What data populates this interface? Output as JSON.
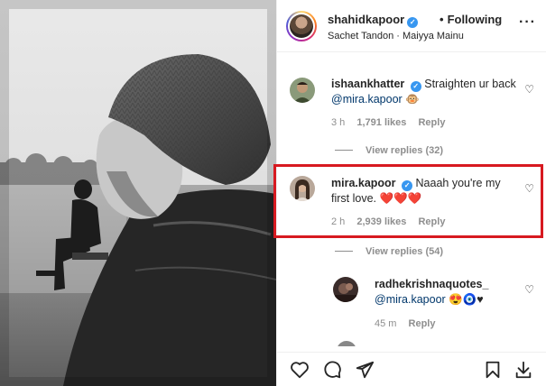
{
  "post": {
    "username": "shahidkapoor",
    "follow_status": "Following",
    "audio_line": "Sachet Tandon · Maiyya Mainu",
    "more_label": "···"
  },
  "comments": [
    {
      "username": "ishaankhatter",
      "text": "Straighten ur back",
      "mention": "@mira.kapoor",
      "emoji": "🐵",
      "time": "3 h",
      "likes": "1,791 likes",
      "reply": "Reply",
      "view_replies": "View replies (32)"
    },
    {
      "username": "mira.kapoor",
      "text_line1": "Naaah you're my",
      "text_line2": "first love.",
      "emoji": "❤️❤️❤️",
      "time": "2 h",
      "likes": "2,939 likes",
      "reply": "Reply",
      "view_replies": "View replies (54)"
    }
  ],
  "reply": {
    "username": "radhekrishnaquotes_",
    "mention": "@mira.kapoor",
    "emoji": "😍🧿♥",
    "time": "45 m",
    "reply": "Reply"
  },
  "colors": {
    "highlight_border": "#d71920",
    "verified_blue": "#3897f0",
    "mention_blue": "#00376b",
    "muted": "#8e8e8e"
  },
  "icons": [
    "heart-icon",
    "comment-icon",
    "share-icon",
    "bookmark-icon",
    "download-icon",
    "verified-icon",
    "more-icon"
  ]
}
